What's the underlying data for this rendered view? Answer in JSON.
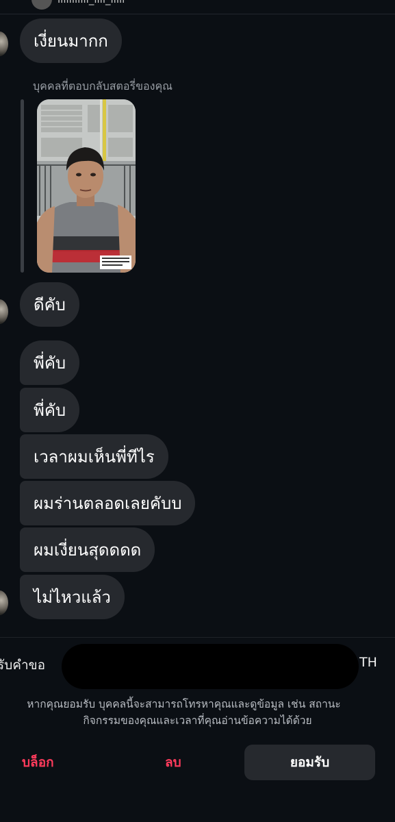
{
  "header": {
    "name_partial": "lllllllllll_llll_lllll"
  },
  "messages": {
    "m1": "เงี่ยนมากก",
    "reply_label": "บุคคลที่ตอบกลับสตอรี่ของคุณ",
    "m2": "ดีคับ",
    "m3": "พี่คับ",
    "m4": "พี่คับ",
    "m5": "เวลาผมเห็นพี่ทีไร",
    "m6": "ผมร่านตลอดเลยคับบ",
    "m7": "ผมเงี่ยนสุดดดด",
    "m8": "ไม่ไหวแล้ว"
  },
  "request": {
    "title_start": "รับคำขอ",
    "title_end": "TH",
    "desc_line1": "หากคุณยอมรับ บุคคลนี้จะสามารถโทรหาคุณและดูข้อมูล เช่น สถานะ",
    "desc_line2": "กิจกรรมของคุณและเวลาที่คุณอ่านข้อความได้ด้วย",
    "block_label": "บล็อก",
    "delete_label": "ลบ",
    "accept_label": "ยอมรับ"
  },
  "colors": {
    "background": "#0b0f14",
    "bubble": "#26292e",
    "danger": "#ff3b5c",
    "muted_text": "#9a9fa6"
  }
}
